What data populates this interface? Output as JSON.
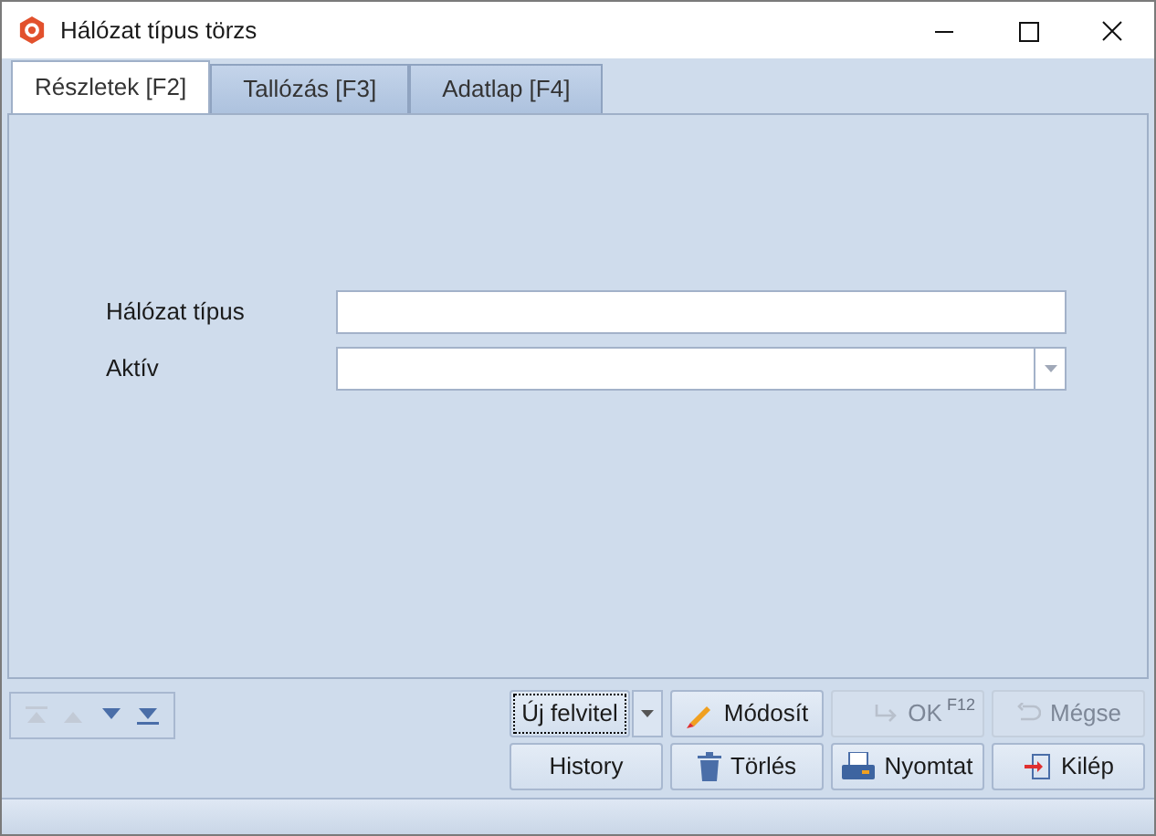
{
  "window": {
    "title": "Hálózat típus törzs"
  },
  "tabs": [
    {
      "label": "Részletek [F2]",
      "selected": true
    },
    {
      "label": "Tallózás [F3]",
      "selected": false
    },
    {
      "label": "Adatlap [F4]",
      "selected": false
    }
  ],
  "fields": [
    {
      "label": "Hálózat típus",
      "kind": "text"
    },
    {
      "label": "Aktív",
      "kind": "combo"
    }
  ],
  "navigation": [
    {
      "kind": "first",
      "disabled": true
    },
    {
      "kind": "prev",
      "disabled": true
    },
    {
      "kind": "next",
      "disabled": false
    },
    {
      "kind": "last",
      "disabled": false
    }
  ],
  "buttons": [
    {
      "label": "Új felvitel",
      "kind": "new",
      "disabled": false
    },
    {
      "label": "Módosít",
      "kind": "edit",
      "disabled": false
    },
    {
      "label": "OK",
      "kind": "ok",
      "disabled": true,
      "shortcut": "F12"
    },
    {
      "label": "Mégse",
      "kind": "cancel",
      "disabled": true
    },
    {
      "label": "History",
      "kind": "history",
      "disabled": false
    },
    {
      "label": "Törlés",
      "kind": "delete",
      "disabled": false
    },
    {
      "label": "Nyomtat",
      "kind": "print",
      "disabled": false
    },
    {
      "label": "Kilép",
      "kind": "exit",
      "disabled": false
    }
  ]
}
